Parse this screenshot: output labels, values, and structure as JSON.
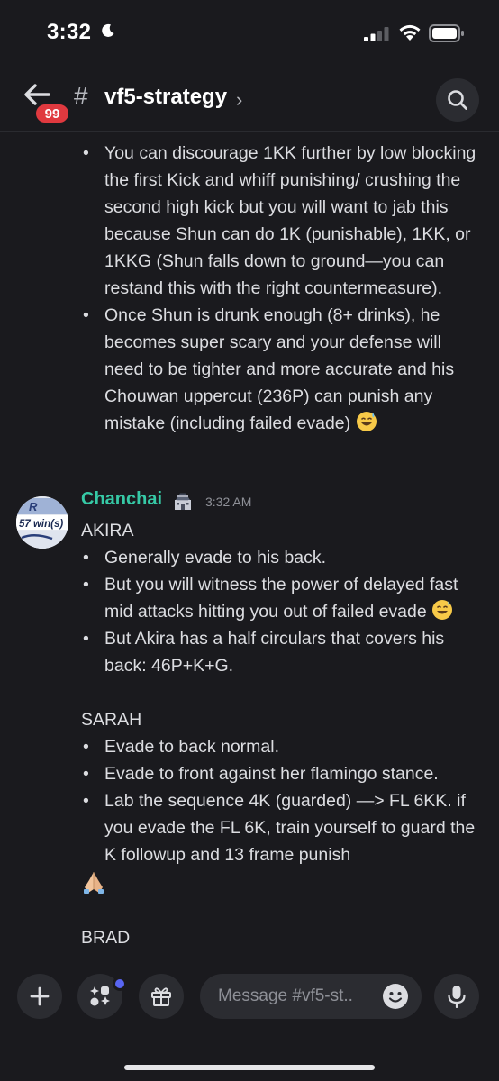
{
  "status_bar": {
    "time": "3:32"
  },
  "header": {
    "unread_badge": "99",
    "hash": "#",
    "channel_name": "vf5-strategy",
    "chevron": "›"
  },
  "previous_message": {
    "bullets": [
      "You can discourage 1KK further by low blocking the first Kick and whiff punishing/ crushing the second high kick but you will want to jab this because Shun can do 1K (punishable), 1KK, or 1KKG (Shun falls down to ground—you can restand this with the right countermeasure).",
      "Once Shun is drunk enough (8+ drinks), he becomes super scary and your defense will need to be tighter and more accurate and his Chouwan uppercut (236P) can punish any mistake (including failed evade)"
    ]
  },
  "message": {
    "author": "Chanchai",
    "timestamp": "3:32 AM",
    "avatar_text": "57 win(s)",
    "sections": [
      {
        "heading": "AKIRA",
        "bullets": [
          "Generally evade to his back.",
          "But you will witness the power of delayed fast mid attacks hitting you out of failed evade",
          "But Akira has a half circulars that covers his back: 46P+K+G."
        ]
      },
      {
        "heading": "SARAH",
        "bullets": [
          "Evade to back normal.",
          "Evade to front against her flamingo stance.",
          "Lab the sequence 4K (guarded) —> FL 6KK. if you evade the FL 6K, train yourself to guard the K followup and 13 frame punish"
        ]
      },
      {
        "heading": "BRAD"
      }
    ]
  },
  "composer": {
    "placeholder": "Message #vf5-st..",
    "buttons": [
      "plus-icon",
      "apps-icon",
      "gift-icon",
      "emoji-icon",
      "microphone-icon"
    ]
  },
  "colors": {
    "background": "#1a1a1e",
    "author_name": "#36c9a6",
    "badge": "#e0393f",
    "notification_dot": "#5865f2",
    "button_bg": "#2b2c31"
  }
}
